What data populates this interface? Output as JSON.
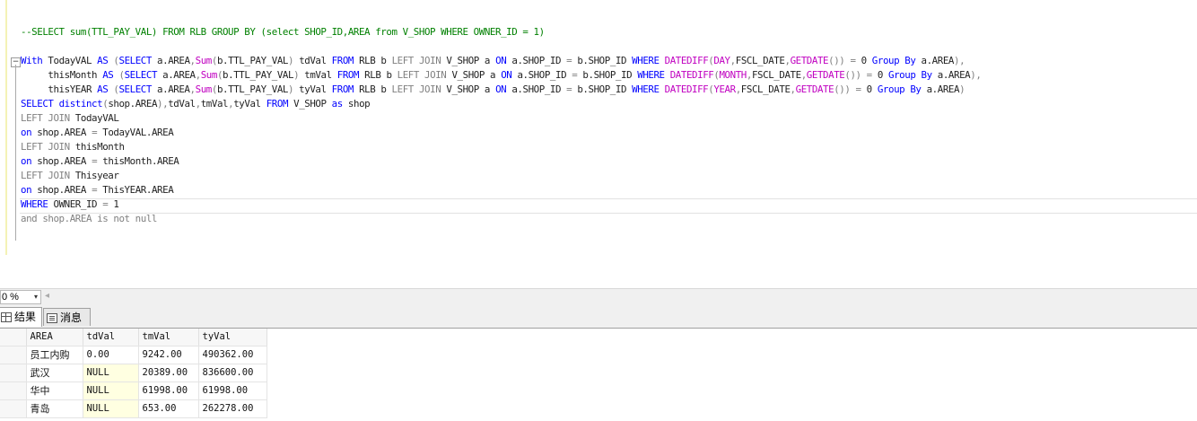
{
  "editor": {
    "lines": [
      {
        "segments": [
          {
            "t": "--SELECT sum(TTL_PAY_VAL) FROM RLB GROUP BY (select SHOP_ID,AREA from V_SHOP WHERE OWNER_ID = 1)",
            "c": "cm"
          }
        ]
      },
      {
        "segments": [
          {
            "t": "With ",
            "c": "kw"
          },
          {
            "t": "TodayVAL ",
            "c": "tx"
          },
          {
            "t": "AS ",
            "c": "kw"
          },
          {
            "t": "(",
            "c": "gr"
          },
          {
            "t": "SELECT ",
            "c": "kw"
          },
          {
            "t": "a.AREA",
            "c": "tx"
          },
          {
            "t": ",",
            "c": "gr"
          },
          {
            "t": "Sum",
            "c": "fn"
          },
          {
            "t": "(",
            "c": "gr"
          },
          {
            "t": "b.TTL_PAY_VAL",
            "c": "tx"
          },
          {
            "t": ") ",
            "c": "gr"
          },
          {
            "t": "tdVal ",
            "c": "tx"
          },
          {
            "t": "FROM ",
            "c": "kw"
          },
          {
            "t": "RLB b ",
            "c": "tx"
          },
          {
            "t": "LEFT JOIN ",
            "c": "gr"
          },
          {
            "t": "V_SHOP a ",
            "c": "tx"
          },
          {
            "t": "ON ",
            "c": "kw"
          },
          {
            "t": "a.SHOP_ID ",
            "c": "tx"
          },
          {
            "t": "= ",
            "c": "gr"
          },
          {
            "t": "b.SHOP_ID ",
            "c": "tx"
          },
          {
            "t": "WHERE ",
            "c": "kw"
          },
          {
            "t": "DATEDIFF",
            "c": "fn"
          },
          {
            "t": "(",
            "c": "gr"
          },
          {
            "t": "DAY",
            "c": "fn"
          },
          {
            "t": ",",
            "c": "gr"
          },
          {
            "t": "FSCL_DATE",
            "c": "tx"
          },
          {
            "t": ",",
            "c": "gr"
          },
          {
            "t": "GETDATE",
            "c": "fn"
          },
          {
            "t": "()) = ",
            "c": "gr"
          },
          {
            "t": "0 ",
            "c": "tx"
          },
          {
            "t": "Group By ",
            "c": "kw"
          },
          {
            "t": "a.AREA",
            "c": "tx"
          },
          {
            "t": "),",
            "c": "gr"
          }
        ]
      },
      {
        "segments": [
          {
            "t": "     thisMonth ",
            "c": "tx"
          },
          {
            "t": "AS ",
            "c": "kw"
          },
          {
            "t": "(",
            "c": "gr"
          },
          {
            "t": "SELECT ",
            "c": "kw"
          },
          {
            "t": "a.AREA",
            "c": "tx"
          },
          {
            "t": ",",
            "c": "gr"
          },
          {
            "t": "Sum",
            "c": "fn"
          },
          {
            "t": "(",
            "c": "gr"
          },
          {
            "t": "b.TTL_PAY_VAL",
            "c": "tx"
          },
          {
            "t": ") ",
            "c": "gr"
          },
          {
            "t": "tmVal ",
            "c": "tx"
          },
          {
            "t": "FROM ",
            "c": "kw"
          },
          {
            "t": "RLB b ",
            "c": "tx"
          },
          {
            "t": "LEFT JOIN ",
            "c": "gr"
          },
          {
            "t": "V_SHOP a ",
            "c": "tx"
          },
          {
            "t": "ON ",
            "c": "kw"
          },
          {
            "t": "a.SHOP_ID ",
            "c": "tx"
          },
          {
            "t": "= ",
            "c": "gr"
          },
          {
            "t": "b.SHOP_ID ",
            "c": "tx"
          },
          {
            "t": "WHERE ",
            "c": "kw"
          },
          {
            "t": "DATEDIFF",
            "c": "fn"
          },
          {
            "t": "(",
            "c": "gr"
          },
          {
            "t": "MONTH",
            "c": "fn"
          },
          {
            "t": ",",
            "c": "gr"
          },
          {
            "t": "FSCL_DATE",
            "c": "tx"
          },
          {
            "t": ",",
            "c": "gr"
          },
          {
            "t": "GETDATE",
            "c": "fn"
          },
          {
            "t": "()) = ",
            "c": "gr"
          },
          {
            "t": "0 ",
            "c": "tx"
          },
          {
            "t": "Group By ",
            "c": "kw"
          },
          {
            "t": "a.AREA",
            "c": "tx"
          },
          {
            "t": "),",
            "c": "gr"
          }
        ]
      },
      {
        "segments": [
          {
            "t": "     thisYEAR ",
            "c": "tx"
          },
          {
            "t": "AS ",
            "c": "kw"
          },
          {
            "t": "(",
            "c": "gr"
          },
          {
            "t": "SELECT ",
            "c": "kw"
          },
          {
            "t": "a.AREA",
            "c": "tx"
          },
          {
            "t": ",",
            "c": "gr"
          },
          {
            "t": "Sum",
            "c": "fn"
          },
          {
            "t": "(",
            "c": "gr"
          },
          {
            "t": "b.TTL_PAY_VAL",
            "c": "tx"
          },
          {
            "t": ") ",
            "c": "gr"
          },
          {
            "t": "tyVal ",
            "c": "tx"
          },
          {
            "t": "FROM ",
            "c": "kw"
          },
          {
            "t": "RLB b ",
            "c": "tx"
          },
          {
            "t": "LEFT JOIN ",
            "c": "gr"
          },
          {
            "t": "V_SHOP a ",
            "c": "tx"
          },
          {
            "t": "ON ",
            "c": "kw"
          },
          {
            "t": "a.SHOP_ID ",
            "c": "tx"
          },
          {
            "t": "= ",
            "c": "gr"
          },
          {
            "t": "b.SHOP_ID ",
            "c": "tx"
          },
          {
            "t": "WHERE ",
            "c": "kw"
          },
          {
            "t": "DATEDIFF",
            "c": "fn"
          },
          {
            "t": "(",
            "c": "gr"
          },
          {
            "t": "YEAR",
            "c": "fn"
          },
          {
            "t": ",",
            "c": "gr"
          },
          {
            "t": "FSCL_DATE",
            "c": "tx"
          },
          {
            "t": ",",
            "c": "gr"
          },
          {
            "t": "GETDATE",
            "c": "fn"
          },
          {
            "t": "()) = ",
            "c": "gr"
          },
          {
            "t": "0 ",
            "c": "tx"
          },
          {
            "t": "Group By ",
            "c": "kw"
          },
          {
            "t": "a.AREA",
            "c": "tx"
          },
          {
            "t": ")",
            "c": "gr"
          }
        ]
      },
      {
        "segments": [
          {
            "t": "SELECT ",
            "c": "kw"
          },
          {
            "t": "distinct",
            "c": "kw"
          },
          {
            "t": "(",
            "c": "gr"
          },
          {
            "t": "shop.AREA",
            "c": "tx"
          },
          {
            "t": "),",
            "c": "gr"
          },
          {
            "t": "tdVal",
            "c": "tx"
          },
          {
            "t": ",",
            "c": "gr"
          },
          {
            "t": "tmVal",
            "c": "tx"
          },
          {
            "t": ",",
            "c": "gr"
          },
          {
            "t": "tyVal ",
            "c": "tx"
          },
          {
            "t": "FROM ",
            "c": "kw"
          },
          {
            "t": "V_SHOP ",
            "c": "tx"
          },
          {
            "t": "as ",
            "c": "kw"
          },
          {
            "t": "shop",
            "c": "tx"
          }
        ]
      },
      {
        "segments": [
          {
            "t": "LEFT JOIN ",
            "c": "gr"
          },
          {
            "t": "TodayVAL",
            "c": "tx"
          }
        ]
      },
      {
        "segments": [
          {
            "t": "on ",
            "c": "kw"
          },
          {
            "t": "shop.AREA ",
            "c": "tx"
          },
          {
            "t": "= ",
            "c": "gr"
          },
          {
            "t": "TodayVAL.AREA",
            "c": "tx"
          }
        ]
      },
      {
        "segments": [
          {
            "t": "LEFT JOIN ",
            "c": "gr"
          },
          {
            "t": "thisMonth",
            "c": "tx"
          }
        ]
      },
      {
        "segments": [
          {
            "t": "on ",
            "c": "kw"
          },
          {
            "t": "shop.AREA ",
            "c": "tx"
          },
          {
            "t": "= ",
            "c": "gr"
          },
          {
            "t": "thisMonth.AREA",
            "c": "tx"
          }
        ]
      },
      {
        "segments": [
          {
            "t": "LEFT JOIN ",
            "c": "gr"
          },
          {
            "t": "Thisyear",
            "c": "tx"
          }
        ]
      },
      {
        "segments": [
          {
            "t": "on ",
            "c": "kw"
          },
          {
            "t": "shop.AREA ",
            "c": "tx"
          },
          {
            "t": "= ",
            "c": "gr"
          },
          {
            "t": "ThisYEAR.AREA",
            "c": "tx"
          }
        ]
      },
      {
        "segments": [
          {
            "t": "WHERE ",
            "c": "kw"
          },
          {
            "t": "OWNER_ID ",
            "c": "tx"
          },
          {
            "t": "= ",
            "c": "gr"
          },
          {
            "t": "1",
            "c": "tx"
          }
        ]
      },
      {
        "segments": [
          {
            "t": "and shop.AREA is not null",
            "c": "gr"
          }
        ]
      }
    ]
  },
  "zoom": {
    "value": "0 %",
    "arrow": "▾",
    "scroll_left": "◂"
  },
  "tabs": {
    "collapse_glyph": "−",
    "results_label": "结果",
    "messages_label": "消息"
  },
  "grid": {
    "columns": [
      "AREA",
      "tdVal",
      "tmVal",
      "tyVal"
    ],
    "rows": [
      [
        "员工内购",
        "0.00",
        "9242.00",
        "490362.00"
      ],
      [
        "武汉",
        "NULL",
        "20389.00",
        "836600.00"
      ],
      [
        "华中",
        "NULL",
        "61998.00",
        "61998.00"
      ],
      [
        "青岛",
        "NULL",
        "653.00",
        "262278.00"
      ]
    ]
  },
  "colors": {
    "keyword": "#0000ff",
    "function": "#c000c0",
    "operator": "#808080",
    "comment": "#008000",
    "null_cell": "#ffffe1"
  }
}
